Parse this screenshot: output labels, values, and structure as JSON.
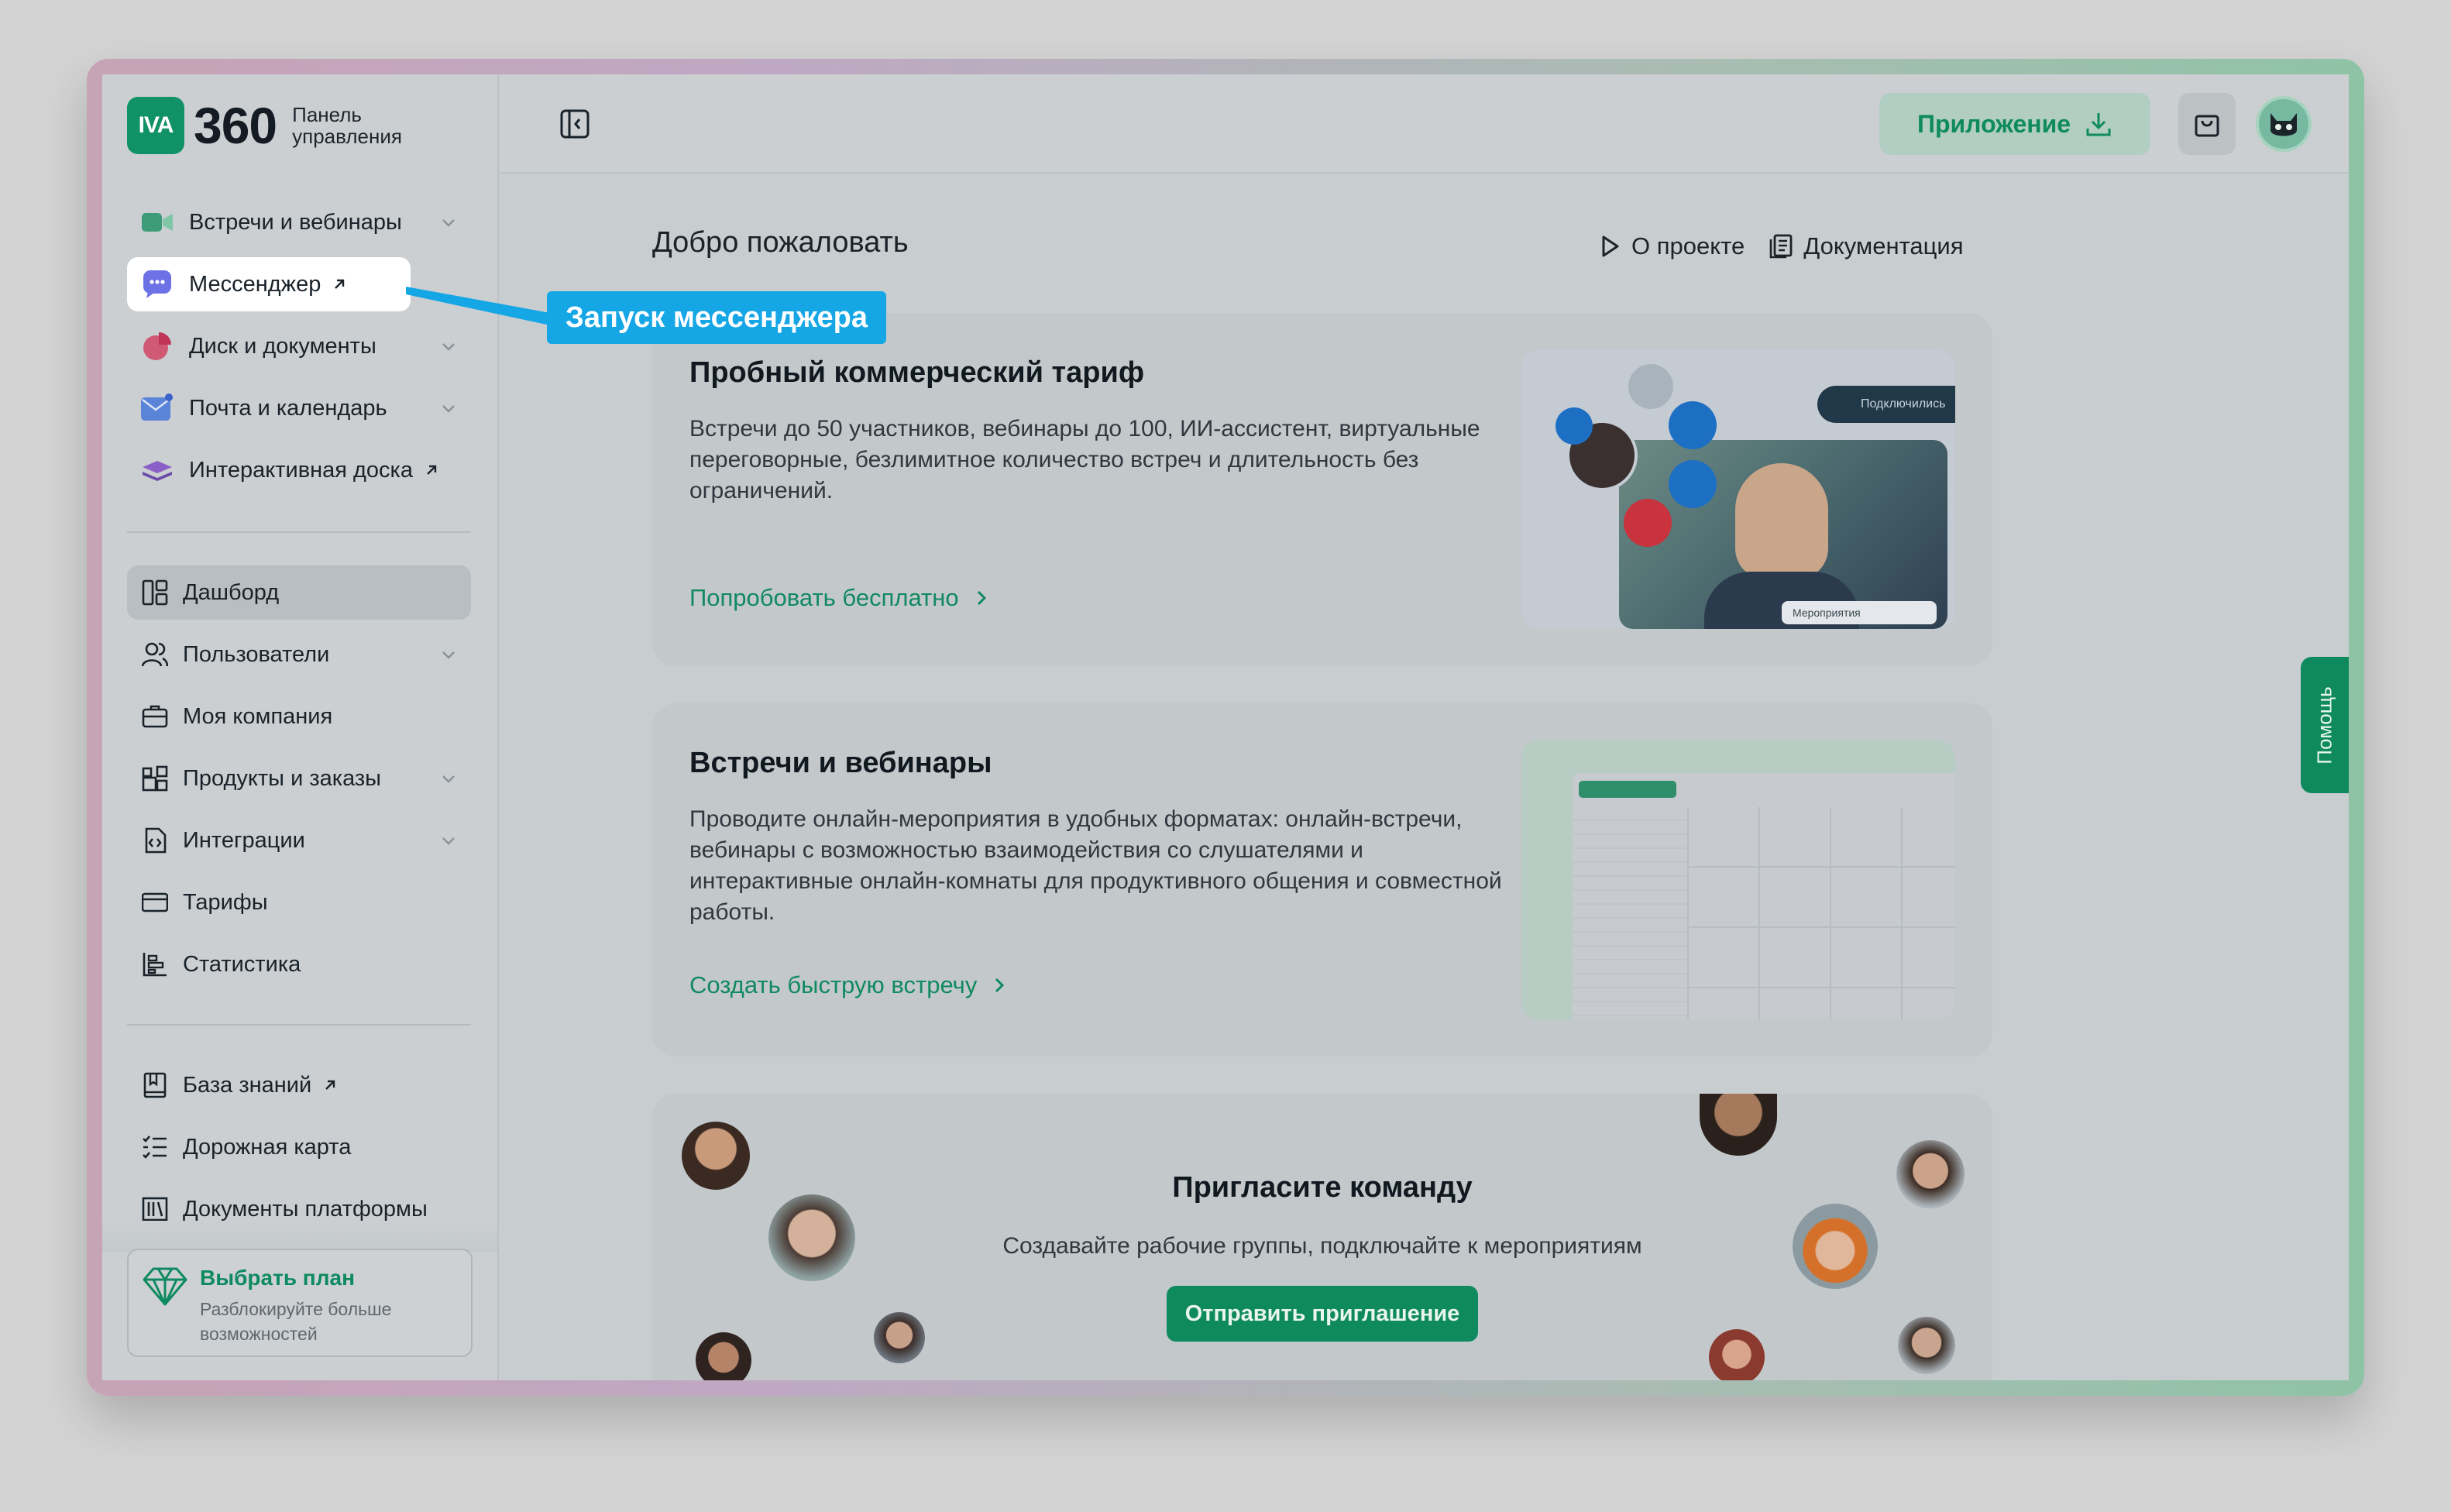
{
  "brand": {
    "badge": "IVA",
    "number": "360",
    "subtitle_line1": "Панель",
    "subtitle_line2": "управления"
  },
  "sidebar": {
    "apps": [
      {
        "label": "Встречи и вебинары",
        "icon": "video-camera-icon",
        "chevron": true
      },
      {
        "label": "Мессенджер",
        "icon": "chat-bubble-icon",
        "external": true
      },
      {
        "label": "Диск и документы",
        "icon": "pie-chart-icon",
        "chevron": true
      },
      {
        "label": "Почта и календарь",
        "icon": "envelope-icon",
        "chevron": true
      },
      {
        "label": "Интерактивная доска",
        "icon": "layers-icon",
        "external": true
      }
    ],
    "admin": [
      {
        "label": "Дашборд",
        "icon": "dashboard-icon",
        "active": true
      },
      {
        "label": "Пользователи",
        "icon": "users-icon",
        "chevron": true
      },
      {
        "label": "Моя компания",
        "icon": "briefcase-icon"
      },
      {
        "label": "Продукты и заказы",
        "icon": "apps-grid-icon",
        "chevron": true
      },
      {
        "label": "Интеграции",
        "icon": "code-file-icon",
        "chevron": true
      },
      {
        "label": "Тарифы",
        "icon": "credit-card-icon"
      },
      {
        "label": "Статистика",
        "icon": "stats-icon"
      }
    ],
    "resources": [
      {
        "label": "База знаний",
        "icon": "book-icon",
        "external": true
      },
      {
        "label": "Дорожная карта",
        "icon": "checklist-icon"
      },
      {
        "label": "Документы платформы",
        "icon": "library-icon"
      }
    ],
    "plan": {
      "title": "Выбрать план",
      "subtitle": "Разблокируйте больше возможностей"
    }
  },
  "topbar": {
    "app_button": "Приложение"
  },
  "main": {
    "welcome": "Добро пожаловать",
    "links": {
      "about": "О проекте",
      "docs": "Документация"
    },
    "trial_card": {
      "title": "Пробный коммерческий тариф",
      "text": "Встречи до 50 участников, вебинары до 100, ИИ-ассистент, виртуальные переговорные, безлимитное количество встреч и длительность без ограничений.",
      "link": "Попробовать бесплатно",
      "illus_badge": "Подключились",
      "illus_tag": "Мероприятия"
    },
    "meet_card": {
      "title": "Встречи и вебинары",
      "text": "Проводите онлайн-мероприятия в удобных форматах: онлайн-встречи, вебинары с возможностью взаимодействия со слушателями и интерактивные онлайн-комнаты для продуктивного общения и совместной работы.",
      "link": "Создать быструю встречу"
    },
    "invite_card": {
      "title": "Пригласите команду",
      "text": "Создавайте рабочие группы, подключайте к мероприятиям",
      "button": "Отправить приглашение"
    }
  },
  "help_tab": "Помощь",
  "tooltip": "Запуск мессенджера",
  "colors": {
    "accent": "#0f8a5e",
    "tooltip": "#15a6e6",
    "highlight": "#ffffff"
  }
}
